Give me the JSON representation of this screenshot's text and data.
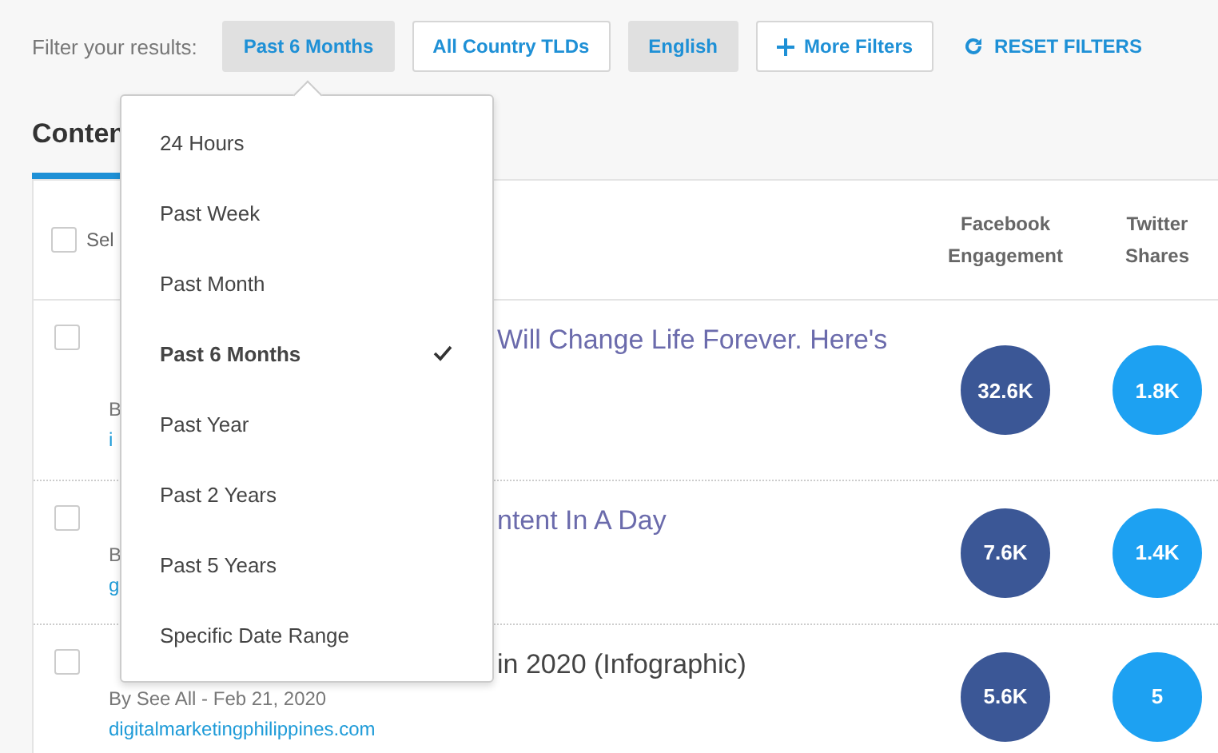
{
  "filter_bar": {
    "label": "Filter your results:",
    "filters": [
      {
        "label": "Past 6 Months",
        "kind": "toggle",
        "selected": true
      },
      {
        "label": "All Country TLDs",
        "kind": "toggle",
        "selected": false
      },
      {
        "label": "English",
        "kind": "toggle",
        "selected": true
      },
      {
        "label": "More Filters",
        "kind": "add",
        "selected": false
      }
    ],
    "reset_label": "RESET FILTERS"
  },
  "tabs": [
    {
      "label": "Conten",
      "selected": true
    }
  ],
  "table": {
    "select_all": {
      "label": "Sel",
      "checked": false
    },
    "columns": [
      "Facebook Engagement",
      "Twitter Shares"
    ],
    "rows": [
      {
        "checked": false,
        "visited": true,
        "title_tail": "Will Change Life Forever. Here's",
        "byline": "B",
        "link": "i",
        "facebook": "32.6K",
        "twitter": "1.8K"
      },
      {
        "checked": false,
        "visited": true,
        "title_tail": "ntent In A Day",
        "byline": "B",
        "link": "g",
        "facebook": "7.6K",
        "twitter": "1.4K"
      },
      {
        "checked": false,
        "visited": false,
        "title_tail": "in 2020 (Infographic)",
        "byline": "By See All - Feb 21, 2020",
        "link": "digitalmarketingphilippines.com",
        "facebook": "5.6K",
        "twitter": "5"
      }
    ]
  },
  "dropdown": {
    "options": [
      {
        "label": "24 Hours",
        "selected": false
      },
      {
        "label": "Past Week",
        "selected": false
      },
      {
        "label": "Past Month",
        "selected": false
      },
      {
        "label": "Past 6 Months",
        "selected": true
      },
      {
        "label": "Past Year",
        "selected": false
      },
      {
        "label": "Past 2 Years",
        "selected": false
      },
      {
        "label": "Past 5 Years",
        "selected": false
      },
      {
        "label": "Specific Date Range",
        "selected": false
      }
    ]
  }
}
